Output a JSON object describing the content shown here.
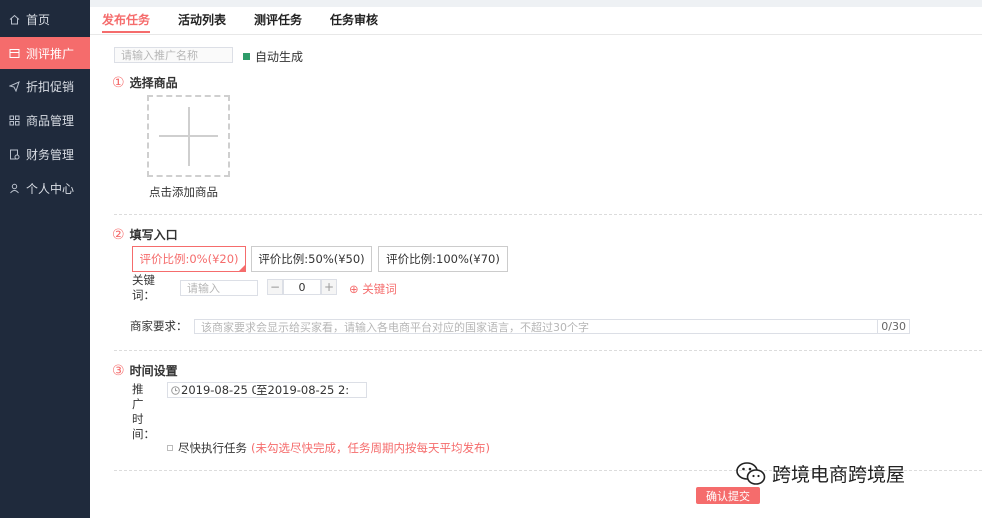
{
  "sidebar": {
    "items": [
      {
        "label": "首页",
        "icon": "home-icon"
      },
      {
        "label": "测评推广",
        "icon": "promo-icon",
        "active": true
      },
      {
        "label": "折扣促销",
        "icon": "send-icon"
      },
      {
        "label": "商品管理",
        "icon": "grid-icon"
      },
      {
        "label": "财务管理",
        "icon": "finance-icon"
      },
      {
        "label": "个人中心",
        "icon": "user-icon"
      }
    ]
  },
  "tabs": [
    "发布任务",
    "活动列表",
    "测评任务",
    "任务审核"
  ],
  "promo_name": {
    "placeholder": "请输入推广名称",
    "auto_label": "自动生成",
    "auto_checked": true
  },
  "section1": {
    "num": "①",
    "title": "选择商品",
    "add_label": "点击添加商品"
  },
  "section2": {
    "num": "②",
    "title": "填写入口",
    "ratios": [
      "评价比例:0%(¥20)",
      "评价比例:50%(¥50)",
      "评价比例:100%(¥70)"
    ],
    "selected_ratio": 0,
    "keyword_label": "关键词：",
    "keyword_placeholder": "请输入",
    "stepper_value": "0",
    "add_keyword": "⊕ 关键词",
    "req_label": "商家要求：",
    "req_placeholder": "该商家要求会显示给买家看，请输入各电商平台对应的国家语言，不超过30个字",
    "req_count": "0/30"
  },
  "section3": {
    "num": "③",
    "title": "时间设置",
    "time_label": "推广时间：",
    "start": "2019-08-25 0(",
    "sep": "至",
    "end": "2019-08-25 2:",
    "asap_label": "尽快执行任务",
    "asap_note": "(未勾选尽快完成，任务周期内按每天平均发布)"
  },
  "submit_label": "确认提交",
  "watermark": "跨境电商跨境屋",
  "colors": {
    "accent": "#f56c6c",
    "sidebar": "#1f2a3c"
  }
}
